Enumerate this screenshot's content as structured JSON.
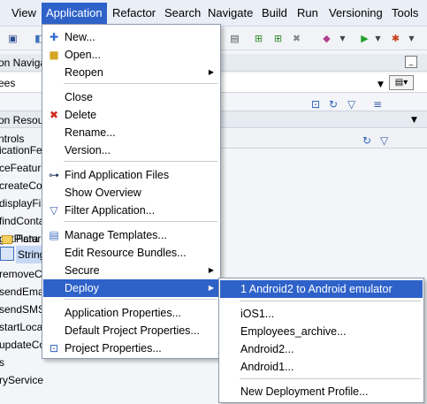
{
  "menubar": {
    "items": [
      "View",
      "Application",
      "Refactor",
      "Search",
      "Navigate",
      "Build",
      "Run",
      "Versioning",
      "Tools"
    ]
  },
  "left_panel": {
    "nav_label": "on Navigat",
    "dropdown_value": "ees",
    "resources_label": "on Resour",
    "controls_label": "ntrols",
    "tree": [
      "icationFea",
      "ceFeature",
      "createCo",
      "displayFile",
      "findConta",
      "getPicture",
      "Para",
      "String",
      "removeCo",
      "sendEmail",
      "sendSMS",
      "startLoca",
      "updateCo",
      "s",
      "ryService"
    ]
  },
  "app_menu": {
    "items": [
      {
        "label": "New...",
        "icon": "new-icon"
      },
      {
        "label": "Open...",
        "icon": "folder-icon"
      },
      {
        "label": "Reopen",
        "submenu": true
      },
      {
        "label": "Close"
      },
      {
        "label": "Delete",
        "icon": "delete-icon"
      },
      {
        "label": "Rename..."
      },
      {
        "label": "Version..."
      },
      {
        "label": "Find Application Files",
        "icon": "binoculars-icon"
      },
      {
        "label": "Show Overview"
      },
      {
        "label": "Filter Application...",
        "icon": "filter-icon"
      },
      {
        "label": "Manage Templates...",
        "icon": "templates-icon"
      },
      {
        "label": "Edit Resource Bundles..."
      },
      {
        "label": "Secure",
        "submenu": true
      },
      {
        "label": "Deploy",
        "submenu": true,
        "highlighted": true
      },
      {
        "label": "Application Properties..."
      },
      {
        "label": "Default Project Properties..."
      },
      {
        "label": "Project Properties...",
        "icon": "properties-icon"
      }
    ]
  },
  "deploy_submenu": {
    "items": [
      {
        "label": "1 Android2 to Android emulator",
        "highlighted": true
      },
      {
        "label": "iOS1..."
      },
      {
        "label": "Employees_archive..."
      },
      {
        "label": "Android2..."
      },
      {
        "label": "Android1..."
      },
      {
        "label": "New Deployment Profile..."
      }
    ]
  },
  "colors": {
    "highlight": "#2e62c9",
    "menubar_bg": "#e9eef7",
    "menu_border": "#8e99ab"
  }
}
